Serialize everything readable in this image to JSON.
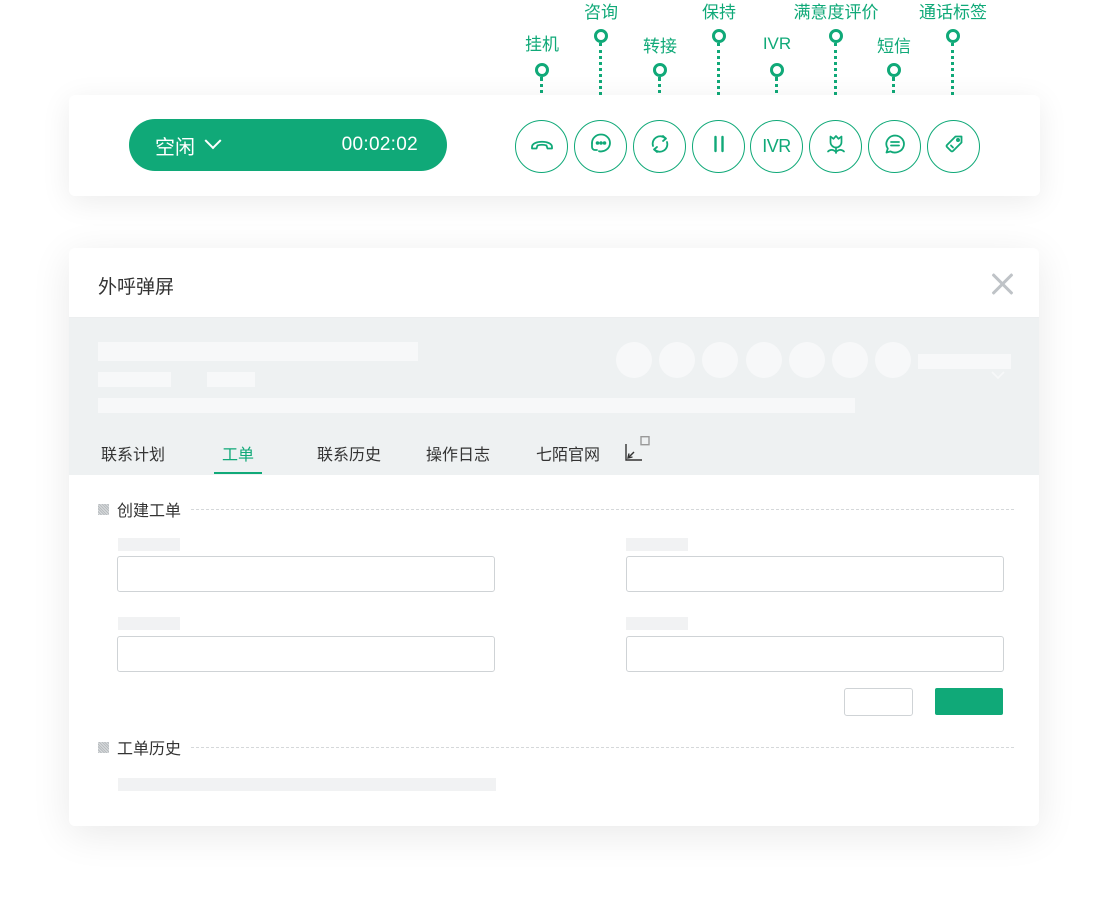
{
  "toolbar": {
    "status_label": "空闲",
    "timer": "00:02:02",
    "buttons": [
      {
        "label": "挂机",
        "icon": "hangup-icon"
      },
      {
        "label": "咨询",
        "icon": "consult-icon"
      },
      {
        "label": "转接",
        "icon": "transfer-icon"
      },
      {
        "label": "保持",
        "icon": "hold-icon"
      },
      {
        "label": "IVR",
        "icon": "ivr-icon",
        "text": "IVR"
      },
      {
        "label": "满意度评价",
        "icon": "satisfaction-icon"
      },
      {
        "label": "短信",
        "icon": "sms-icon"
      },
      {
        "label": "通话标签",
        "icon": "tag-icon"
      }
    ]
  },
  "panel": {
    "title": "外呼弹屏",
    "tabs": [
      "联系计划",
      "工单",
      "联系历史",
      "操作日志",
      "七陌官网"
    ],
    "active_tab": "工单",
    "sections": {
      "create": "创建工单",
      "history": "工单历史"
    }
  },
  "colors": {
    "accent": "#10a978",
    "info_bg": "#eef1f2"
  }
}
